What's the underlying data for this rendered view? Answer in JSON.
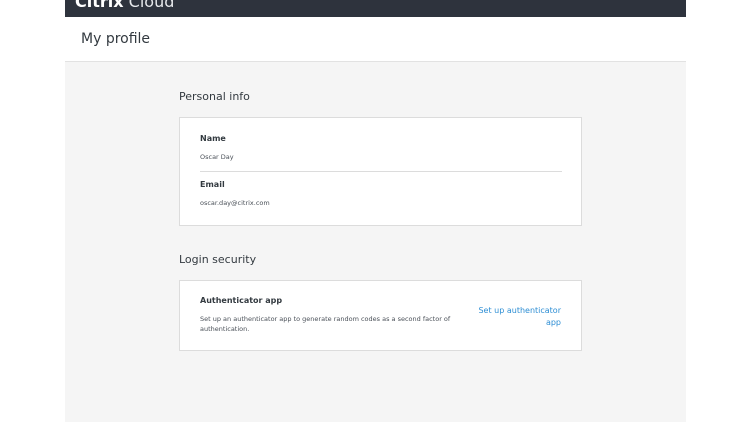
{
  "brand": {
    "bold": "Citrix",
    "light": "Cloud"
  },
  "page": {
    "title": "My profile"
  },
  "personal_info": {
    "title": "Personal info",
    "name_label": "Name",
    "name_value": "Oscar Day",
    "email_label": "Email",
    "email_value": "oscar.day@citrix.com"
  },
  "login_security": {
    "title": "Login security",
    "authenticator_label": "Authenticator app",
    "authenticator_description": "Set up an authenticator app to generate random codes as a second factor of authentication.",
    "setup_link": "Set up authenticator app"
  },
  "colors": {
    "header_bg": "#2e333d",
    "page_bg": "#f5f5f5",
    "card_bg": "#ffffff",
    "link": "#2d8ed4"
  }
}
